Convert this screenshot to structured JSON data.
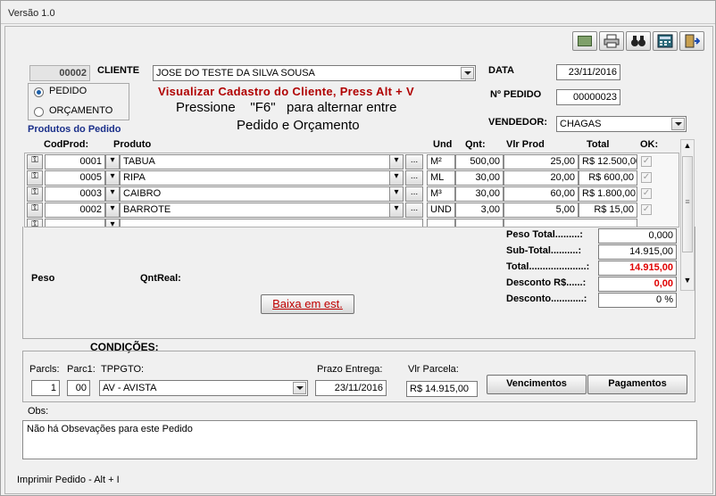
{
  "window": {
    "title": "Versão 1.0"
  },
  "toolbar": {
    "icons": [
      "money-icon",
      "printer-icon",
      "binoculars-icon",
      "calculator-icon",
      "exit-door-icon"
    ]
  },
  "header": {
    "code": "00002",
    "client_label": "CLIENTE",
    "client_value": "JOSE DO TESTE DA SILVA SOUSA",
    "date_label": "DATA",
    "date_value": "23/11/2016",
    "order_number_label": "Nº PEDIDO",
    "order_number_value": "00000023",
    "seller_label": "VENDEDOR:",
    "seller_value": "CHAGAS",
    "radio_pedido": "PEDIDO",
    "radio_orcamento": "ORÇAMENTO",
    "hint_client": "Visualizar Cadastro do Cliente, Press  Alt + V",
    "hint_f6_line1": "Pressione    \"F6\"   para alternar entre",
    "hint_f6_line2": "Pedido e Orçamento",
    "products_title": "Produtos do Pedido"
  },
  "grid": {
    "headers": {
      "codprod": "CodProd:",
      "produto": "Produto",
      "und": "Und",
      "qnt": "Qnt:",
      "vlrprod": "Vlr Prod",
      "total": "Total",
      "ok": "OK:"
    },
    "rows": [
      {
        "code": "0001",
        "product": "TABUA",
        "unit": "M²",
        "qty": "500,00",
        "price": "25,00",
        "total": "R$ 12.500,00",
        "ok": "✓"
      },
      {
        "code": "0005",
        "product": "RIPA",
        "unit": "ML",
        "qty": "30,00",
        "price": "20,00",
        "total": "R$ 600,00",
        "ok": "✓"
      },
      {
        "code": "0003",
        "product": "CAIBRO",
        "unit": "M³",
        "qty": "30,00",
        "price": "60,00",
        "total": "R$ 1.800,00",
        "ok": "✓"
      },
      {
        "code": "0002",
        "product": "BARROTE",
        "unit": "UND",
        "qty": "3,00",
        "price": "5,00",
        "total": "R$ 15,00",
        "ok": "✓"
      }
    ],
    "ellipsis": "..."
  },
  "totals": {
    "peso_total_label": "Peso Total.........:",
    "peso_total_value": "0,000",
    "subtotal_label": "Sub-Total..........:",
    "subtotal_value": "14.915,00",
    "total_label": "Total.....................:",
    "total_value": "14.915,00",
    "desconto_rs_label": "Desconto R$......:",
    "desconto_rs_value": "0,00",
    "desconto_label": "Desconto............:",
    "desconto_value": "0 %"
  },
  "peso_label": "Peso",
  "qntreal_label": "QntReal:",
  "baixa_button": "Baixa em est.",
  "conditions": {
    "title": "CONDIÇÕES:",
    "parcls_label": "Parcls:",
    "parcls_value": "1",
    "parc1_label": "Parc1:",
    "parc1_value": "00",
    "tppgto_label": "TPPGTO:",
    "tppgto_value": "AV - AVISTA",
    "prazo_label": "Prazo Entrega:",
    "prazo_value": "23/11/2016",
    "vlr_parcela_label": "Vlr Parcela:",
    "vlr_parcela_value": "R$ 14.915,00",
    "vencimentos_button": "Vencimentos",
    "pagamentos_button": "Pagamentos"
  },
  "obs": {
    "label": "Obs:",
    "value": "Não há Obsevações para este Pedido"
  },
  "footer": {
    "shortcut": "Imprimir Pedido - Alt + I"
  },
  "colors": {
    "hint_red": "#b00000",
    "title_blue": "#1a2f8a",
    "total_red": "#e00000"
  }
}
